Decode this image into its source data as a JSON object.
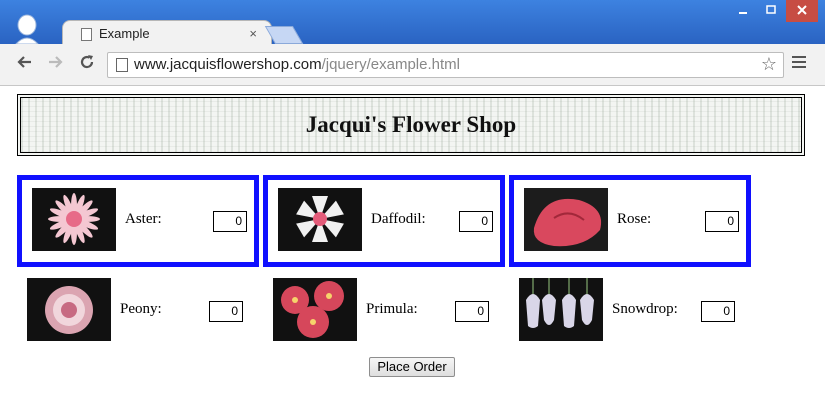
{
  "browser": {
    "tab_title": "Example",
    "tab_close": "×",
    "url_host": "www.jacquisflowershop.com",
    "url_path": "/jquery/example.html"
  },
  "page": {
    "title": "Jacqui's Flower Shop",
    "order_button": "Place Order",
    "flowers": [
      {
        "name": "Aster:",
        "quantity": "0",
        "highlighted": true,
        "icon": "aster-icon",
        "color": "#e76a88"
      },
      {
        "name": "Daffodil:",
        "quantity": "0",
        "highlighted": true,
        "icon": "daffodil-icon",
        "color": "#e45c7a"
      },
      {
        "name": "Rose:",
        "quantity": "0",
        "highlighted": true,
        "icon": "rose-icon",
        "color": "#d9485e"
      },
      {
        "name": "Peony:",
        "quantity": "0",
        "highlighted": false,
        "icon": "peony-icon",
        "color": "#dba4b1"
      },
      {
        "name": "Primula:",
        "quantity": "0",
        "highlighted": false,
        "icon": "primula-icon",
        "color": "#d6475b"
      },
      {
        "name": "Snowdrop:",
        "quantity": "0",
        "highlighted": false,
        "icon": "snowdrop-icon",
        "color": "#d9d6e8"
      }
    ]
  },
  "colors": {
    "highlight_border": "#1010ff",
    "titlebar": "#2f6fd0"
  }
}
